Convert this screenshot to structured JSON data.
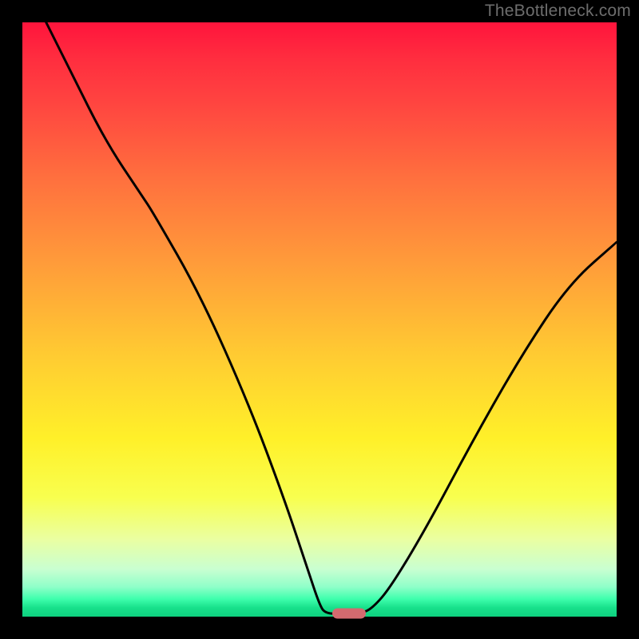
{
  "watermark": "TheBottleneck.com",
  "colors": {
    "background": "#000000",
    "curve_stroke": "#000000",
    "marker": "#d46a6f",
    "watermark_text": "#6d6d6d",
    "gradient_stops": [
      {
        "offset": 0,
        "color": "#ff143c"
      },
      {
        "offset": 0.06,
        "color": "#ff2d3f"
      },
      {
        "offset": 0.14,
        "color": "#ff4640"
      },
      {
        "offset": 0.26,
        "color": "#ff6f3e"
      },
      {
        "offset": 0.4,
        "color": "#ff9a3a"
      },
      {
        "offset": 0.56,
        "color": "#ffcb32"
      },
      {
        "offset": 0.7,
        "color": "#fff029"
      },
      {
        "offset": 0.8,
        "color": "#f8ff4f"
      },
      {
        "offset": 0.87,
        "color": "#eaffa2"
      },
      {
        "offset": 0.92,
        "color": "#c9ffd1"
      },
      {
        "offset": 0.95,
        "color": "#8fffc9"
      },
      {
        "offset": 0.97,
        "color": "#3fffad"
      },
      {
        "offset": 0.985,
        "color": "#18e08b"
      },
      {
        "offset": 1.0,
        "color": "#0ed17f"
      }
    ]
  },
  "chart_data": {
    "type": "line",
    "title": "",
    "xlabel": "",
    "ylabel": "",
    "x_range": [
      0,
      100
    ],
    "y_range": [
      0,
      100
    ],
    "curve_points": [
      {
        "x": 4,
        "y": 100
      },
      {
        "x": 8,
        "y": 92
      },
      {
        "x": 14,
        "y": 80
      },
      {
        "x": 20,
        "y": 71
      },
      {
        "x": 22,
        "y": 68
      },
      {
        "x": 30,
        "y": 54
      },
      {
        "x": 38,
        "y": 36
      },
      {
        "x": 44,
        "y": 20
      },
      {
        "x": 48,
        "y": 8
      },
      {
        "x": 50,
        "y": 2
      },
      {
        "x": 51,
        "y": 0.5
      },
      {
        "x": 54,
        "y": 0.5
      },
      {
        "x": 57,
        "y": 0.5
      },
      {
        "x": 59,
        "y": 1.5
      },
      {
        "x": 62,
        "y": 5
      },
      {
        "x": 68,
        "y": 15
      },
      {
        "x": 76,
        "y": 30
      },
      {
        "x": 84,
        "y": 44
      },
      {
        "x": 92,
        "y": 56
      },
      {
        "x": 100,
        "y": 63
      }
    ],
    "marker": {
      "x": 55,
      "y": 0.5
    }
  }
}
